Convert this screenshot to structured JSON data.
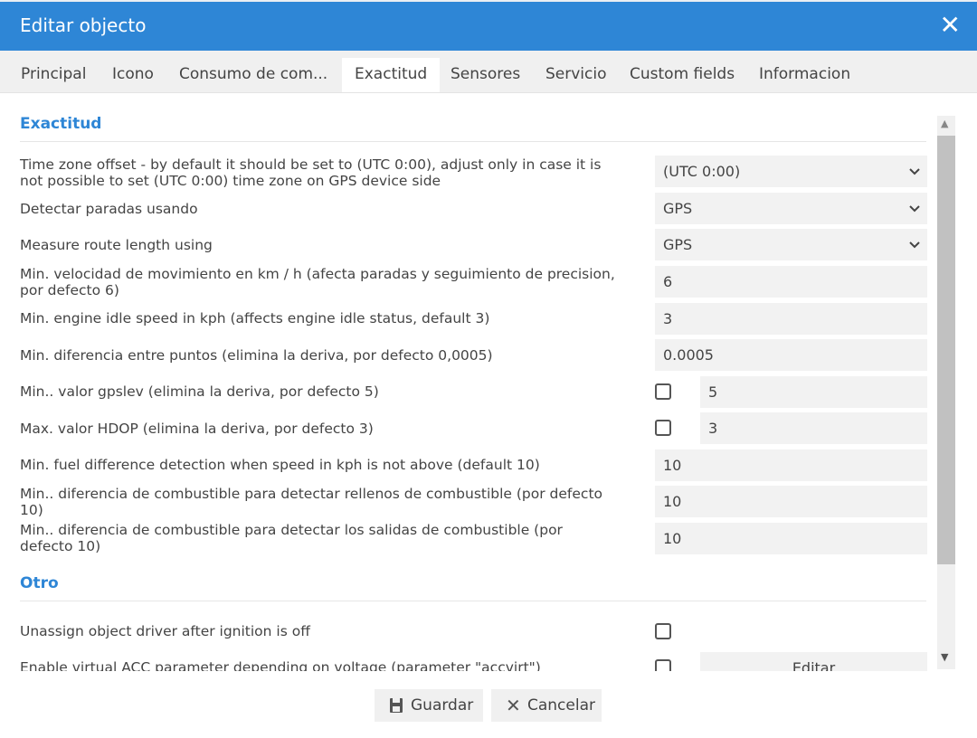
{
  "window": {
    "title": "Editar objecto",
    "close_icon": "close-icon"
  },
  "tabs": [
    {
      "label": "Principal"
    },
    {
      "label": "Icono"
    },
    {
      "label": "Consumo de com..."
    },
    {
      "label": "Exactitud",
      "active": true
    },
    {
      "label": "Sensores"
    },
    {
      "label": "Servicio"
    },
    {
      "label": "Custom fields"
    },
    {
      "label": "Informacion"
    }
  ],
  "sections": {
    "exactitud": "Exactitud",
    "otro": "Otro"
  },
  "fields": {
    "timezone": {
      "label": "Time zone offset - by default it should be set to (UTC 0:00), adjust only in case it is not possible to set (UTC 0:00) time zone on GPS device side",
      "value": "(UTC 0:00)"
    },
    "detect_stops": {
      "label": "Detectar paradas usando",
      "value": "GPS"
    },
    "route_length": {
      "label": "Measure route length using",
      "value": "GPS"
    },
    "min_speed": {
      "label": "Min. velocidad de movimiento en km / h (afecta paradas y seguimiento de precision, por defecto 6)",
      "value": "6"
    },
    "engine_idle": {
      "label": "Min. engine idle speed in kph (affects engine idle status, default 3)",
      "value": "3"
    },
    "min_distance": {
      "label": "Min. diferencia entre puntos (elimina la deriva, por defecto 0,0005)",
      "value": "0.0005"
    },
    "gpslev": {
      "label": "Min.. valor gpslev (elimina la deriva, por defecto 5)",
      "value": "5",
      "checked": false
    },
    "hdop": {
      "label": "Max. valor HDOP (elimina la deriva, por defecto 3)",
      "value": "3",
      "checked": false
    },
    "fuel_speed": {
      "label": "Min. fuel difference detection when speed in kph is not above (default 10)",
      "value": "10"
    },
    "fuel_fill": {
      "label": "Min.. diferencia de combustible para detectar rellenos de combustible (por defecto 10)",
      "value": "10"
    },
    "fuel_drain": {
      "label": "Min.. diferencia de combustible para detectar los salidas de combustible (por defecto 10)",
      "value": "10"
    },
    "unassign_driver": {
      "label": "Unassign object driver after ignition is off",
      "checked": false
    },
    "virtual_acc": {
      "label": "Enable virtual ACC parameter depending on voltage (parameter \"accvirt\")",
      "checked": false,
      "button": "Editar"
    }
  },
  "footer": {
    "save": "Guardar",
    "cancel": "Cancelar"
  },
  "colors": {
    "accent": "#2e86d6"
  }
}
